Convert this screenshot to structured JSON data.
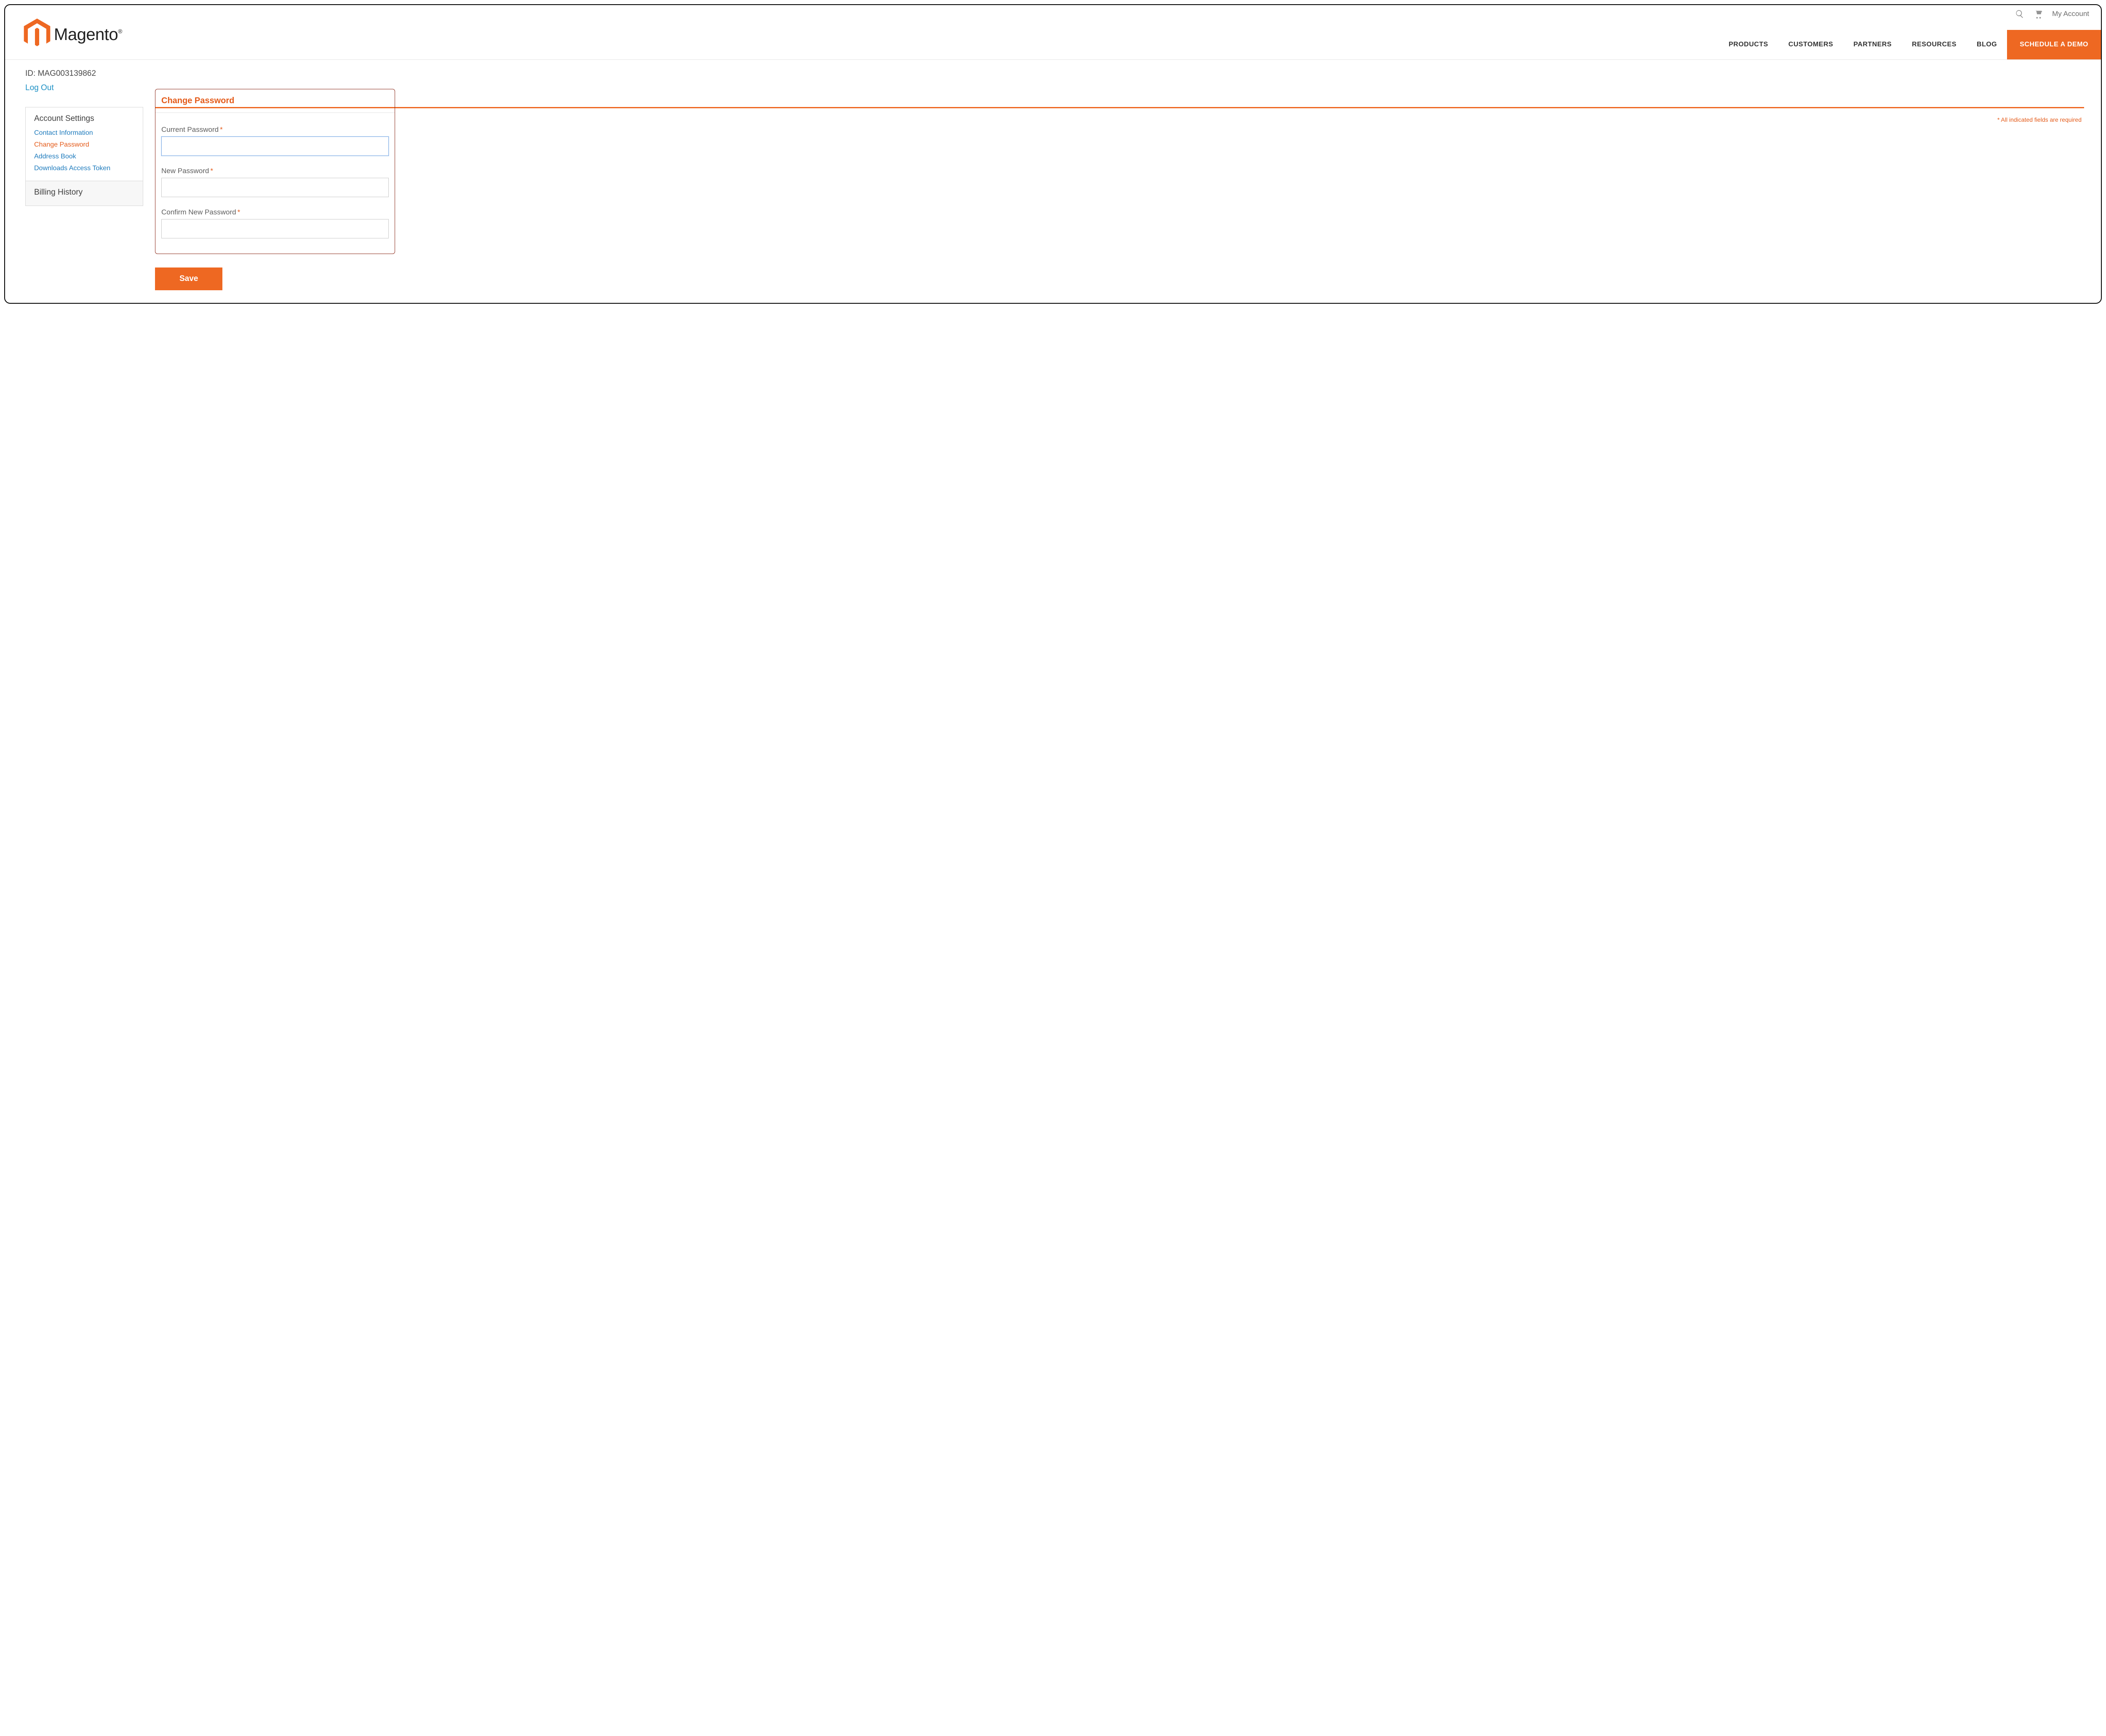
{
  "topbar": {
    "account_link": "My Account"
  },
  "brand": {
    "name": "Magento",
    "mark": "®"
  },
  "nav": {
    "items": [
      "PRODUCTS",
      "CUSTOMERS",
      "PARTNERS",
      "RESOURCES",
      "BLOG"
    ],
    "cta": "SCHEDULE A DEMO"
  },
  "account": {
    "id_label": "ID:",
    "id_value": "MAG003139862",
    "logout": "Log Out"
  },
  "sidebar": {
    "settings_title": "Account Settings",
    "links": {
      "contact": "Contact Information",
      "change_password": "Change Password",
      "address_book": "Address Book",
      "downloads_token": "Downloads Access Token"
    },
    "billing_title": "Billing History"
  },
  "form": {
    "title": "Change Password",
    "required_note": "* All indicated fields are required",
    "current_label": "Current Password",
    "new_label": "New Password",
    "confirm_label": "Confirm New Password",
    "save": "Save"
  }
}
